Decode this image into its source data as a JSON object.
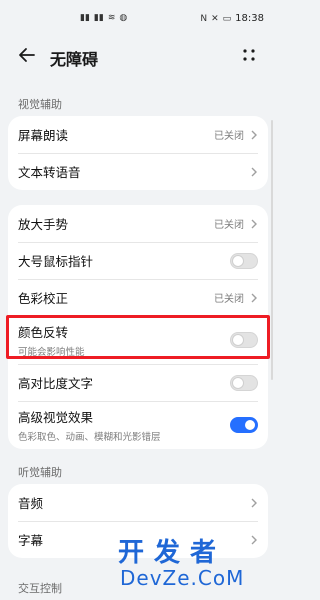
{
  "status": {
    "time": "18:38"
  },
  "header": {
    "title": "无障碍"
  },
  "sections": {
    "visual": "视觉辅助",
    "hearing": "听觉辅助",
    "interaction": "交互控制"
  },
  "visual_card1": {
    "items": [
      {
        "label": "屏幕朗读",
        "value": "已关闭"
      },
      {
        "label": "文本转语音"
      }
    ]
  },
  "visual_card2": {
    "items": [
      {
        "label": "放大手势",
        "value": "已关闭"
      },
      {
        "label": "大号鼠标指针",
        "toggle": false
      },
      {
        "label": "色彩校正",
        "value": "已关闭"
      },
      {
        "label": "颜色反转",
        "subtitle": "可能会影响性能",
        "toggle": false
      },
      {
        "label": "高对比度文字",
        "toggle": false
      },
      {
        "label": "高级视觉效果",
        "subtitle": "色彩取色、动画、模糊和光影错层",
        "toggle": true
      }
    ]
  },
  "hearing_card": {
    "items": [
      {
        "label": "音频"
      },
      {
        "label": "字幕"
      }
    ]
  },
  "watermark": {
    "top": "开发者",
    "bottom": "DevZe.CoM"
  },
  "colors": {
    "accent": "#256fff",
    "highlight": "#ee1c24",
    "watermark": "#1f67d6"
  }
}
